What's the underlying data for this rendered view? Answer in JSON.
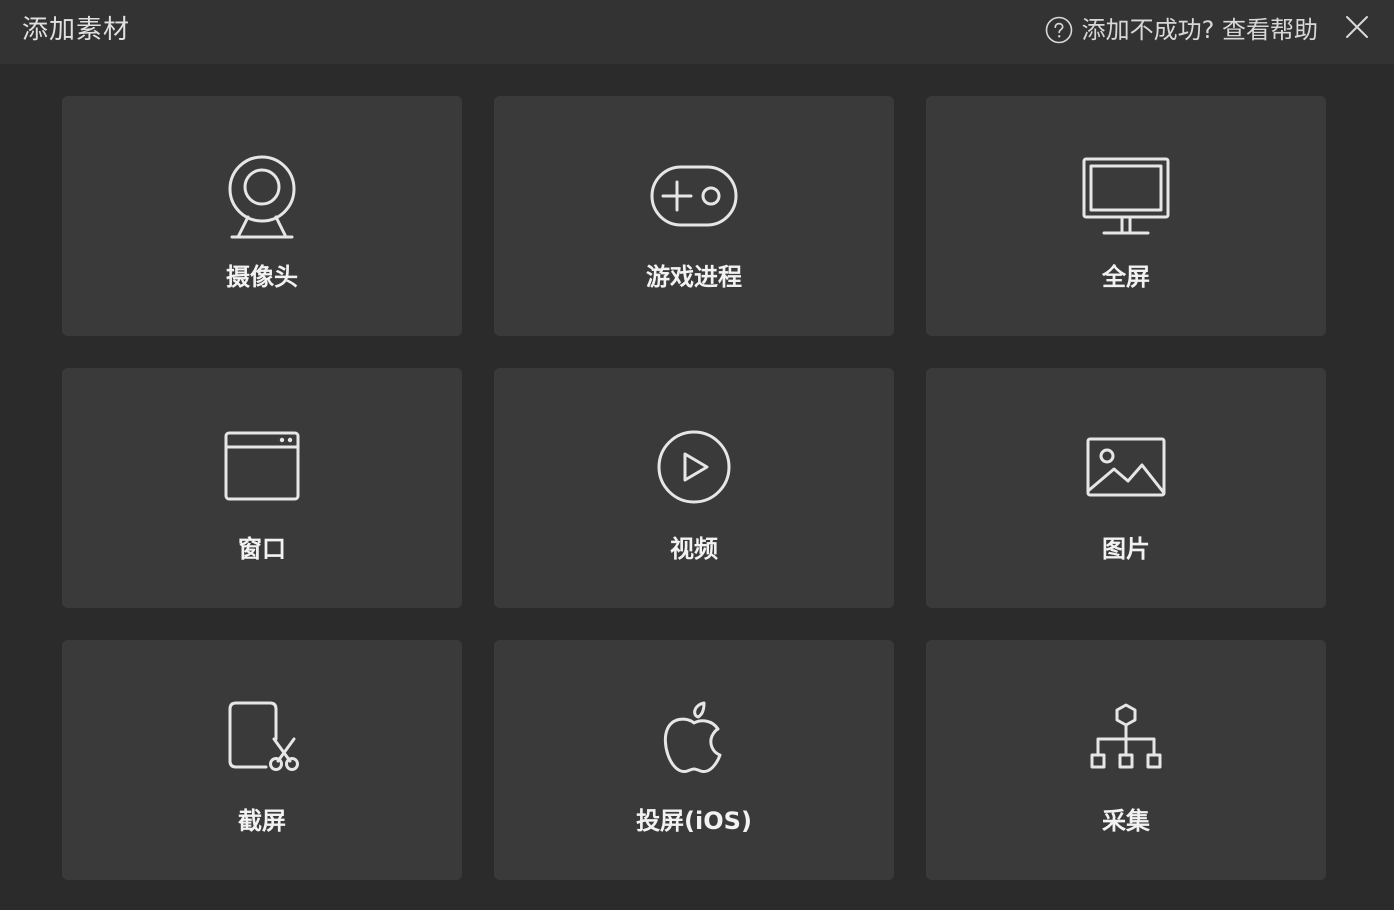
{
  "dialog": {
    "title": "添加素材",
    "help_text": "添加不成功? 查看帮助",
    "help_icon": "question-circle-icon",
    "close_icon": "close-icon"
  },
  "tiles": [
    {
      "label": "摄像头",
      "icon": "webcam-icon"
    },
    {
      "label": "游戏进程",
      "icon": "gamepad-icon"
    },
    {
      "label": "全屏",
      "icon": "monitor-icon"
    },
    {
      "label": "窗口",
      "icon": "window-icon"
    },
    {
      "label": "视频",
      "icon": "play-circle-icon"
    },
    {
      "label": "图片",
      "icon": "image-icon"
    },
    {
      "label": "截屏",
      "icon": "screenshot-scissors-icon"
    },
    {
      "label": "投屏(iOS)",
      "icon": "apple-icon"
    },
    {
      "label": "采集",
      "icon": "network-tree-icon"
    }
  ],
  "colors": {
    "background": "#2b2b2b",
    "titlebar": "#333333",
    "tile": "#3a3a3a",
    "text": "#f2f2f2",
    "icon_stroke": "#e6e6e6"
  }
}
